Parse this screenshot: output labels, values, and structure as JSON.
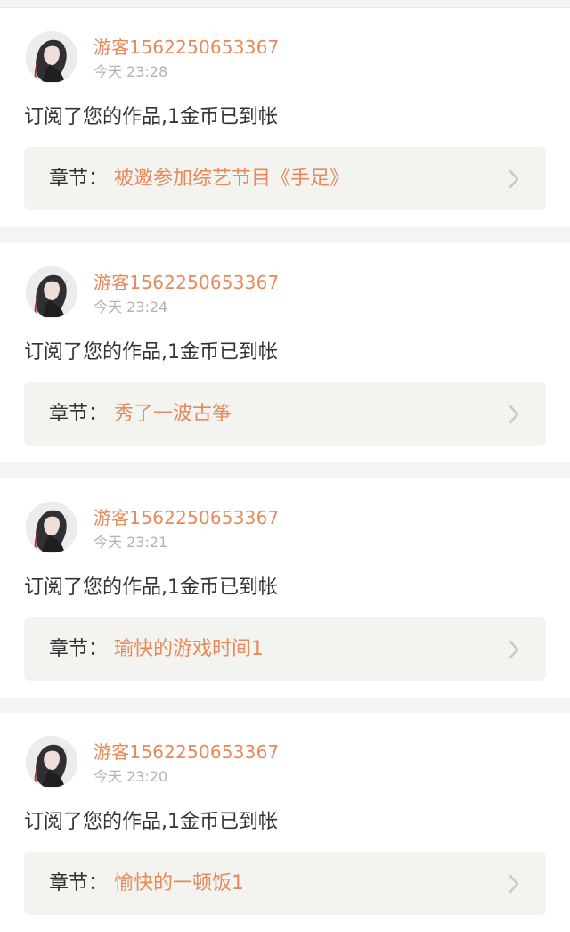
{
  "notifications": [
    {
      "username": "游客1562250653367",
      "time": "今天 23:28",
      "message": "订阅了您的作品,1金币已到帐",
      "chapter_label": "章节：",
      "chapter_title": "被邀参加综艺节目《手足》"
    },
    {
      "username": "游客1562250653367",
      "time": "今天 23:24",
      "message": "订阅了您的作品,1金币已到帐",
      "chapter_label": "章节：",
      "chapter_title": "秀了一波古筝"
    },
    {
      "username": "游客1562250653367",
      "time": "今天 23:21",
      "message": "订阅了您的作品,1金币已到帐",
      "chapter_label": "章节：",
      "chapter_title": "瑜快的游戏时间1"
    },
    {
      "username": "游客1562250653367",
      "time": "今天 23:20",
      "message": "订阅了您的作品,1金币已到帐",
      "chapter_label": "章节：",
      "chapter_title": "愉快的一顿饭1"
    }
  ],
  "icons": {
    "avatar": "user-avatar-illustration",
    "chevron": "chevron-right-icon"
  },
  "colors": {
    "accent": "#e7895a",
    "text": "#333333",
    "muted": "#b3b3b3",
    "card_bg": "#ffffff",
    "chapter_bg": "#f3f4ef",
    "page_bg": "#f4f4f4"
  }
}
